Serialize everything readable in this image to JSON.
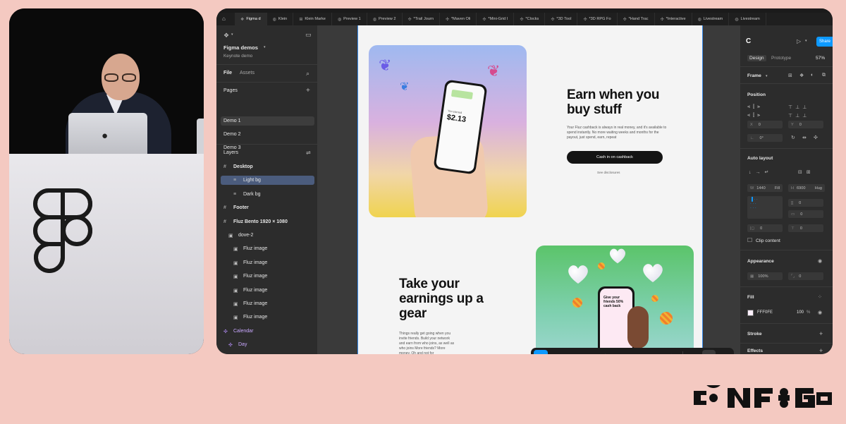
{
  "tabs": [
    {
      "label": "Figma d",
      "icon": "figma-icon",
      "active": true
    },
    {
      "label": "Klein",
      "icon": "globe-icon"
    },
    {
      "label": "Klein Marke",
      "icon": "grid-icon"
    },
    {
      "label": "Preview 1",
      "icon": "globe-icon"
    },
    {
      "label": "Preview 2",
      "icon": "globe-icon"
    },
    {
      "label": "*Trail Journ",
      "icon": "component-icon"
    },
    {
      "label": "*Maven Oli",
      "icon": "component-icon"
    },
    {
      "label": "*Mini-Grid I",
      "icon": "component-icon"
    },
    {
      "label": "*Clocks",
      "icon": "component-icon"
    },
    {
      "label": "*3D Tool",
      "icon": "component-icon"
    },
    {
      "label": "*3D RPG Fo",
      "icon": "component-icon"
    },
    {
      "label": "*Hand Trac",
      "icon": "component-icon"
    },
    {
      "label": "*Interactive",
      "icon": "component-icon"
    },
    {
      "label": "Livestream",
      "icon": "globe-icon"
    },
    {
      "label": "Livestream",
      "icon": "globe-icon"
    }
  ],
  "file": {
    "name": "Figma demos",
    "subtitle": "Keynote demo"
  },
  "panel_tabs": {
    "file": "File",
    "assets": "Assets"
  },
  "pages": {
    "title": "Pages",
    "items": [
      "Demo 1",
      "Demo 2",
      "Demo 3"
    ]
  },
  "layers": {
    "title": "Layers",
    "items": [
      {
        "label": "Desktop",
        "indent": 0,
        "icon": "frame-icon",
        "bold": true
      },
      {
        "label": "Light bg",
        "indent": 2,
        "icon": "layout-icon",
        "selected": true
      },
      {
        "label": "Dark bg",
        "indent": 2,
        "icon": "layout-icon"
      },
      {
        "label": "Footer",
        "indent": 0,
        "icon": "frame-icon",
        "bold": true
      },
      {
        "label": "Fluz Bento 1920 × 1080",
        "indent": 0,
        "icon": "frame-icon",
        "bold": true
      },
      {
        "label": "dove-2",
        "indent": 1,
        "icon": "image-icon"
      },
      {
        "label": "Fluz image",
        "indent": 2,
        "icon": "image-icon"
      },
      {
        "label": "Fluz image",
        "indent": 2,
        "icon": "image-icon"
      },
      {
        "label": "Fluz image",
        "indent": 2,
        "icon": "image-icon"
      },
      {
        "label": "Fluz image",
        "indent": 2,
        "icon": "image-icon"
      },
      {
        "label": "Fluz image",
        "indent": 2,
        "icon": "image-icon"
      },
      {
        "label": "Fluz image",
        "indent": 2,
        "icon": "image-icon"
      },
      {
        "label": "Calendar",
        "indent": 0,
        "icon": "component-icon",
        "purple": true
      },
      {
        "label": "Day",
        "indent": 1,
        "icon": "component-icon",
        "purple": true
      }
    ]
  },
  "canvas": {
    "hero_title": "Earn when you buy stuff",
    "hero_body": "Your Fluz cashback is always in real money, and it's available to spend instantly. No more waiting weeks and months for the payout, just spend, earn, repeat",
    "cta_label": "Cash in on cashback",
    "disclosure": "See disclosures",
    "second_title": "Take your earnings up a gear",
    "second_body": "Things really get going when you invite friends. Build your network and earn from who joins, as well as who joins More friends? More money. Oh and not for",
    "phone1_amount": "$2.13",
    "phone1_caption": "You earned",
    "phone2_text": "Give your friends 50% cash back"
  },
  "toolbar": {
    "tools": [
      {
        "name": "move-tool",
        "icon": "cursor-icon",
        "glyph": "➤",
        "active": true
      },
      {
        "name": "frame-tool",
        "icon": "hash-icon",
        "glyph": "#"
      },
      {
        "name": "rectangle-tool",
        "icon": "square-icon",
        "glyph": "▢"
      },
      {
        "name": "pen-tool",
        "icon": "pen-icon",
        "glyph": "✎"
      },
      {
        "name": "text-tool",
        "icon": "text-icon",
        "glyph": "T"
      },
      {
        "name": "comment-tool",
        "icon": "comment-icon",
        "glyph": "◌"
      },
      {
        "name": "actions-tool",
        "icon": "sparkle-icon",
        "glyph": "✧"
      }
    ],
    "modes": [
      {
        "name": "draw-mode",
        "icon": "draw-icon",
        "glyph": "✐"
      },
      {
        "name": "design-mode",
        "icon": "design-icon",
        "glyph": "◧"
      },
      {
        "name": "dev-mode",
        "icon": "code-icon",
        "glyph": "</>"
      }
    ]
  },
  "right": {
    "share": "Share",
    "tabs": {
      "design": "Design",
      "prototype": "Prototype"
    },
    "zoom": "57%",
    "frame_label": "Frame",
    "position": {
      "title": "Position",
      "x": "0",
      "y": "0",
      "rotation": "0°"
    },
    "auto_layout": {
      "title": "Auto layout",
      "w": "1440",
      "w_mode": "Fill",
      "h": "6900",
      "h_mode": "Hug",
      "gap": "0",
      "padding": "0",
      "pad_h": "0",
      "pad_v": "0"
    },
    "clip_content": "Clip content",
    "appearance": {
      "title": "Appearance",
      "opacity": "100%",
      "radius": "0"
    },
    "fill": {
      "title": "Fill",
      "hex": "FFF0FE",
      "opacity": "100",
      "unit": "%",
      "swatch": "#fff0fe"
    },
    "stroke": "Stroke",
    "effects": "Effects"
  },
  "colors": {
    "accent": "#0d99ff",
    "background": "#f4c9c1",
    "selection": "#4b5c7d"
  }
}
